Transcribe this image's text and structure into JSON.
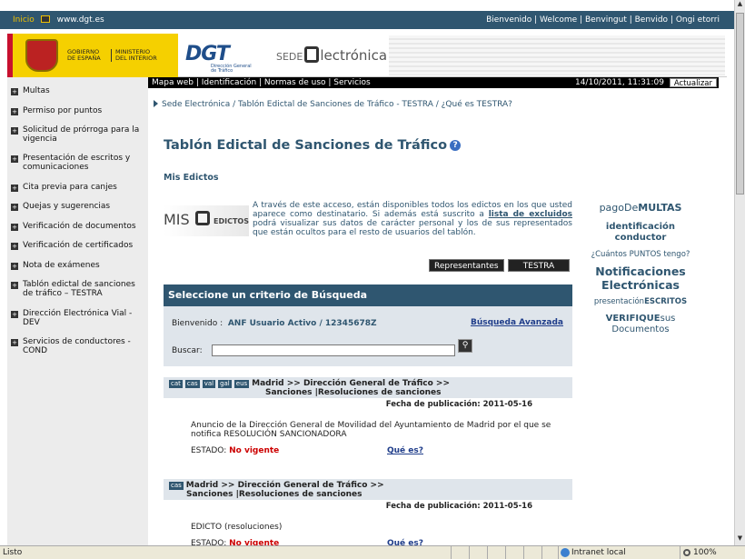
{
  "topbar": {
    "inicio": "Inicio",
    "site": "www.dgt.es",
    "languages": "Bienvenido |  Welcome |  Benvingut |  Benvido |  Ongi etorri"
  },
  "banner": {
    "gov1": "GOBIERNO\nDE ESPAÑA",
    "gov2": "MINISTERIO\nDEL INTERIOR",
    "dgt": "DGT",
    "dgt_sub": "Dirección General\nde Tráfico",
    "sede_pre": "SEDE",
    "sede_post": "lectrónica"
  },
  "navbar": {
    "links": "Mapa web | Identificación | Normas de uso | Servicios",
    "datetime": "14/10/2011, 11:31:09",
    "refresh": "Actualizar"
  },
  "sidebar": {
    "items": [
      {
        "label": "Multas"
      },
      {
        "label": "Permiso por puntos"
      },
      {
        "label": "Solicitud de prórroga para la vigencia"
      },
      {
        "label": "Presentación de escritos y comunicaciones"
      },
      {
        "label": "Cita previa para canjes"
      },
      {
        "label": "Quejas y sugerencias"
      },
      {
        "label": "Verificación de documentos"
      },
      {
        "label": "Verificación de certificados"
      },
      {
        "label": "Nota de exámenes"
      },
      {
        "label": "Tablón edictal de sanciones de tráfico – TESTRA"
      },
      {
        "label": "Dirección Electrónica Vial - DEV"
      },
      {
        "label": "Servicios de conductores - COND"
      }
    ]
  },
  "breadcrumb": "Sede Electrónica  / Tablón Edictal de Sanciones de Tráfico - TESTRA  / ¿Qué es TESTRA?",
  "page_title": "Tablón Edictal de Sanciones de Tráfico",
  "help_icon": "?",
  "mis_edictos": "Mis Edictos",
  "mis_logo": {
    "mis": "MIS",
    "edictos": "EDICTOS"
  },
  "intro": {
    "part1": "A través de este acceso, están disponibles todos los edictos en los que usted aparece como destinatario. Si además está suscrito a ",
    "link": "lista de excluidos",
    "part2": " podrá visualizar sus datos de carácter personal y los de sus representados que están ocultos para el resto de usuarios del tablón."
  },
  "buttons": {
    "representantes": "Representantes",
    "testra": "TESTRA"
  },
  "search": {
    "title": "Seleccione un criterio de Búsqueda",
    "welcome_label": "Bienvenido :",
    "user": "ANF Usuario Activo   /   12345678Z",
    "advanced": "Búsqueda Avanzada",
    "buscar_label": "Buscar:",
    "value": ""
  },
  "results": [
    {
      "tags": [
        "cat",
        "cas",
        "val",
        "gal",
        "eus"
      ],
      "line1": "Madrid >> Dirección General de Tráfico >>",
      "line2": "Sanciones |Resoluciones de sanciones",
      "date": "Fecha de publicación: 2011-05-16",
      "text": "Anuncio de la Dirección General de Movilidad del Ayuntamiento de Madrid por el que se notifica RESOLUCIÓN SANCIONADORA",
      "state_label": "ESTADO:",
      "state": "No vigente",
      "que": "Qué es?"
    },
    {
      "tags": [
        "cas"
      ],
      "line1": "Madrid >> Dirección General de Tráfico >>",
      "line2": "Sanciones |Resoluciones de sanciones",
      "date": "Fecha de publicación: 2011-05-16",
      "text": "EDICTO (resoluciones)",
      "state_label": "ESTADO:",
      "state": "No vigente",
      "que": "Qué es?"
    }
  ],
  "rightcol": {
    "pago_pre": "pagoDe",
    "pago_post": "MULTAS",
    "identificacion": "identificación conductor",
    "puntos": "¿Cuántos PUNTOS tengo?",
    "notificaciones": "Notificaciones Electrónicas",
    "presentacion_pre": "presentación",
    "presentacion_post": "ESCRITOS",
    "verifique_pre": "VERIFIQUE",
    "verifique_post": "sus Documentos"
  },
  "statusbar": {
    "status": "Listo",
    "zone": "Intranet local",
    "zoom": "100%"
  },
  "colors": {
    "primary": "#2f5670",
    "accent": "#f5d000",
    "alert": "#cc0000"
  }
}
